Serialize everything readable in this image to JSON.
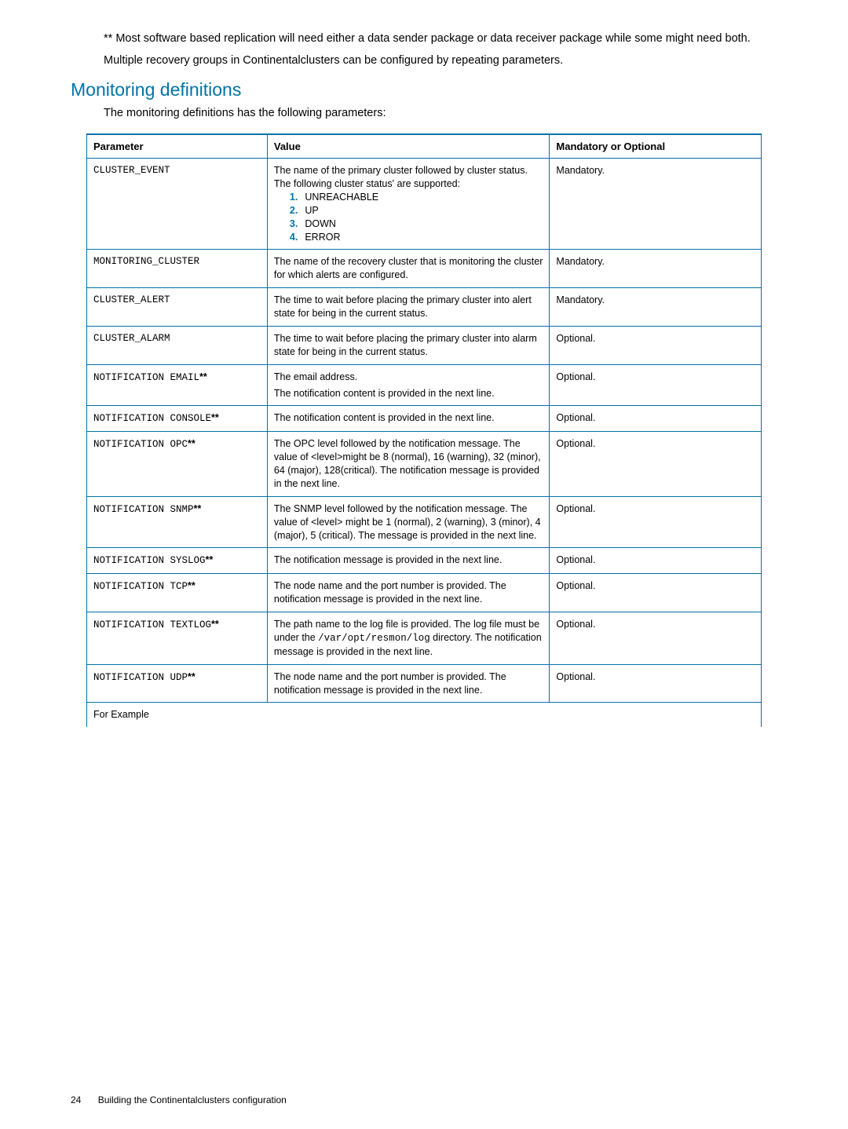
{
  "intro": {
    "p1": "** Most software based replication will need either a data sender package or data receiver package while some might need both.",
    "p2": "Multiple recovery groups in Continentalclusters can be configured by repeating parameters."
  },
  "section": {
    "heading": "Monitoring definitions",
    "sub": "The monitoring definitions has the following parameters:"
  },
  "table": {
    "headers": {
      "param": "Parameter",
      "value": "Value",
      "mandatory": "Mandatory or Optional"
    },
    "rows": [
      {
        "param": "CLUSTER_EVENT",
        "value_intro": "The name of the primary cluster followed by cluster status. The following cluster status' are supported:",
        "items": [
          "UNREACHABLE",
          "UP",
          "DOWN",
          "ERROR"
        ],
        "mandatory": "Mandatory."
      },
      {
        "param": "MONITORING_CLUSTER",
        "value": "The name of the recovery cluster that is monitoring the cluster for which alerts are configured.",
        "mandatory": "Mandatory."
      },
      {
        "param": "CLUSTER_ALERT",
        "value": "The time to wait before placing the primary cluster into alert state for being in the current status.",
        "mandatory": "Mandatory."
      },
      {
        "param": "CLUSTER_ALARM",
        "value": "The time to wait before placing the primary cluster into alarm state for being in the current status.",
        "mandatory": "Optional."
      },
      {
        "param": "NOTIFICATION EMAIL",
        "value_line1": "The email address.",
        "value_line2": "The notification content is provided in the next line.",
        "mandatory": "Optional.",
        "ast": true
      },
      {
        "param": "NOTIFICATION CONSOLE",
        "value": "The notification content is provided in the next line.",
        "mandatory": "Optional.",
        "ast": true
      },
      {
        "param": "NOTIFICATION OPC",
        "value": "The OPC level followed by the notification message. The value of <level>might be 8 (normal), 16 (warning), 32 (minor), 64 (major), 128(critical). The notification message is provided in the next line.",
        "mandatory": "Optional.",
        "ast": true
      },
      {
        "param": "NOTIFICATION SNMP",
        "value": "The SNMP level followed by the notification message. The value of <level> might be 1 (normal), 2 (warning), 3 (minor), 4 (major), 5 (critical). The message is provided in the next line.",
        "mandatory": "Optional.",
        "ast": true
      },
      {
        "param": "NOTIFICATION SYSLOG",
        "value": "The notification message is provided in the next line.",
        "mandatory": "Optional.",
        "ast": true
      },
      {
        "param": "NOTIFICATION TCP",
        "value": "The node name and the port number is provided. The notification message is provided in the next line.",
        "mandatory": "Optional.",
        "ast": true
      },
      {
        "param": "NOTIFICATION TEXTLOG",
        "value_html": "The path name to the log file is provided. The log file must be under the <span class='mono-inline'>/var/opt/resmon/log</span> directory. The notification message is provided in the next line.",
        "mandatory": "Optional.",
        "ast": true
      },
      {
        "param": "NOTIFICATION UDP",
        "value": "The node name and the port number is provided. The notification message is provided in the next line.",
        "mandatory": "Optional.",
        "ast": true
      }
    ],
    "for_example": "For Example"
  },
  "footer": {
    "pagenum": "24",
    "title": "Building the Continentalclusters configuration"
  }
}
